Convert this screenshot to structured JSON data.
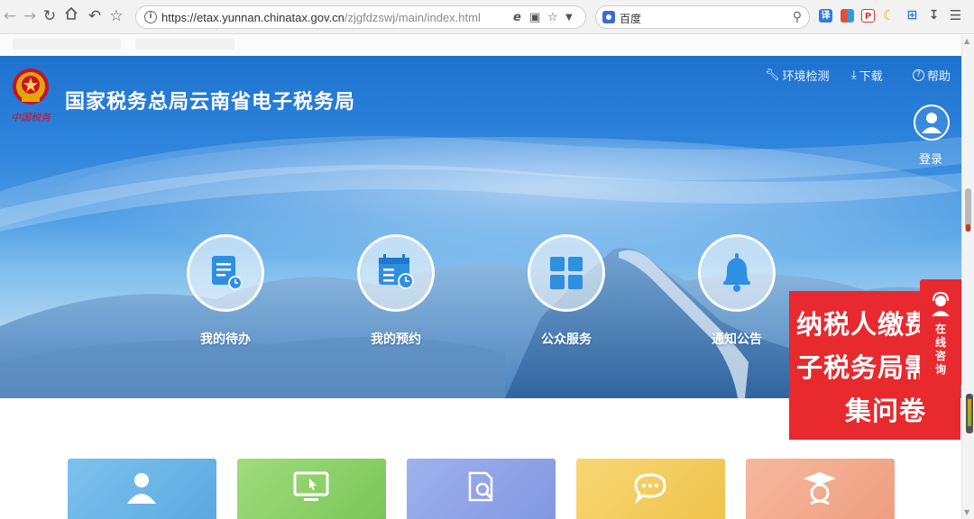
{
  "browser": {
    "url_host": "https://etax.yunnan.chinatax.gov.cn",
    "url_path": "/zjgfdzswj/main/index.html",
    "search_engine_label": "百度",
    "icons": [
      "back-icon",
      "forward-icon",
      "reload-icon",
      "home-icon",
      "undo-icon",
      "bookmark-star-icon",
      "info-icon",
      "ie-mode-icon",
      "screenshot-icon",
      "favorite-icon",
      "dropdown-icon",
      "search-icon",
      "translate-icon",
      "apps-icon",
      "pdf-icon",
      "moon-icon",
      "crop-icon",
      "download-icon",
      "menu-icon"
    ]
  },
  "header": {
    "site_title": "国家税务总局云南省电子税务局",
    "logo_caption": "中国税务",
    "links": {
      "env_check": "环境检测",
      "download": "下载",
      "help": "帮助"
    },
    "login_label": "登录"
  },
  "services": [
    {
      "label": "我的待办",
      "icon": "todo-doc-icon"
    },
    {
      "label": "我的预约",
      "icon": "calendar-clock-icon"
    },
    {
      "label": "公众服务",
      "icon": "grid-icon"
    },
    {
      "label": "通知公告",
      "icon": "bell-icon"
    }
  ],
  "cards": [
    {
      "icon": "user-icon",
      "color": "#6fb7e8"
    },
    {
      "icon": "monitor-icon",
      "color": "#8fd16b"
    },
    {
      "icon": "search-document-icon",
      "color": "#8fa3e6"
    },
    {
      "icon": "chat-bubble-icon",
      "color": "#f4cc5c"
    },
    {
      "icon": "graduate-icon",
      "color": "#f1a98c"
    }
  ],
  "promo": {
    "line1": "纳税人缴费",
    "line2": "子税务局需",
    "line3": "集问卷",
    "color": "#e8292e"
  },
  "consult": {
    "label": "在线咨询"
  },
  "colors": {
    "hero_top": "#1e72cf",
    "accent_red": "#e8292e"
  }
}
